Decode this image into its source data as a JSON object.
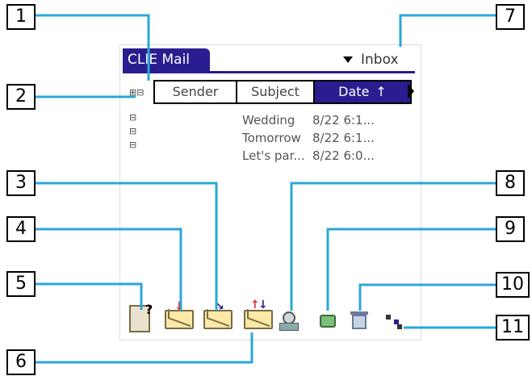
{
  "app": {
    "title": "CLIE Mail",
    "folder": "Inbox"
  },
  "columns": {
    "sender": "Sender",
    "subject": "Subject",
    "date": "Date",
    "sort_icon": "↑"
  },
  "mail": [
    {
      "subject": "Wedding",
      "date": "8/22 6:1..."
    },
    {
      "subject": "Tomorrow",
      "date": "8/22 6:1..."
    },
    {
      "subject": "Let's par...",
      "date": "8/22 6:0..."
    }
  ],
  "callouts": [
    "1",
    "2",
    "3",
    "4",
    "5",
    "6",
    "7",
    "8",
    "9",
    "10",
    "11"
  ],
  "icons": {
    "attachment": "attachment-icon",
    "reply": "reply-icon",
    "compose": "compose-icon",
    "send_receive": "send-receive-icon",
    "address": "address-book-icon",
    "move": "move-folder-icon",
    "delete": "trash-icon",
    "menu": "menu-icon"
  },
  "colors": {
    "accent": "#2a1d8f",
    "envelope": "#fbe9a8"
  }
}
